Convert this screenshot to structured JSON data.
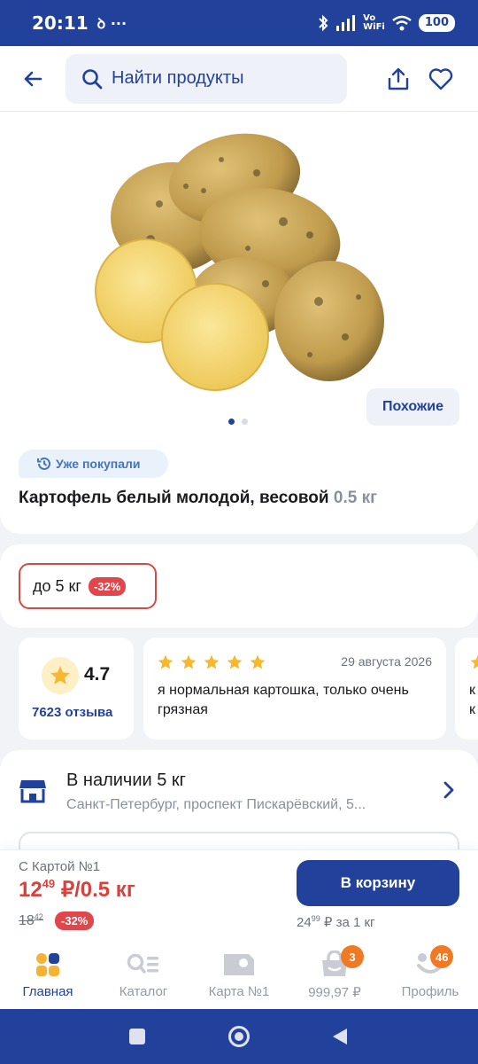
{
  "status_bar": {
    "time": "20:11",
    "extra": "ꝺ ···",
    "vo": "Vo",
    "wifi_text": "WiFi",
    "battery": "100"
  },
  "header": {
    "search_placeholder": "Найти продукты"
  },
  "product": {
    "similar_label": "Похожие",
    "bought_label": "Уже покупали",
    "title": "Картофель белый молодой, весовой",
    "weight": "0.5 кг",
    "gallery_count": 2,
    "gallery_active": 0
  },
  "promo": {
    "label": "до 5 кг",
    "discount": "-32%"
  },
  "rating": {
    "value": "4.7",
    "count": "7623 отзыва"
  },
  "review": {
    "stars": 5,
    "date": "29 августа 2026",
    "text": "я нормальная картошка, только очень грязная"
  },
  "review_peek": {
    "text_line1": "к",
    "text_line2": "к"
  },
  "stock": {
    "title": "В наличии 5 кг",
    "address": "Санкт-Петербург, проспект Пискарёвский, 5..."
  },
  "price": {
    "card_label": "С Картой №1",
    "main_int": "12",
    "main_frac": "49",
    "main_unit": " ₽/0.5 кг",
    "old_int": "18",
    "old_frac": "42",
    "discount": "-32%",
    "cart_button": "В корзину",
    "per_kg_int": "24",
    "per_kg_frac": "99",
    "per_kg_unit": " ₽ за 1 кг"
  },
  "nav": [
    {
      "label": "Главная",
      "icon": "home-icon",
      "active": true
    },
    {
      "label": "Каталог",
      "icon": "catalog-icon"
    },
    {
      "label": "Карта №1",
      "icon": "card-icon"
    },
    {
      "label": "999,97 ₽",
      "icon": "basket-icon",
      "badge": "3"
    },
    {
      "label": "Профиль",
      "icon": "profile-icon",
      "badge": "46"
    }
  ],
  "colors": {
    "brand": "#22419b",
    "sale": "#e0464b",
    "badge": "#f07a24",
    "star": "#f5b82e"
  }
}
